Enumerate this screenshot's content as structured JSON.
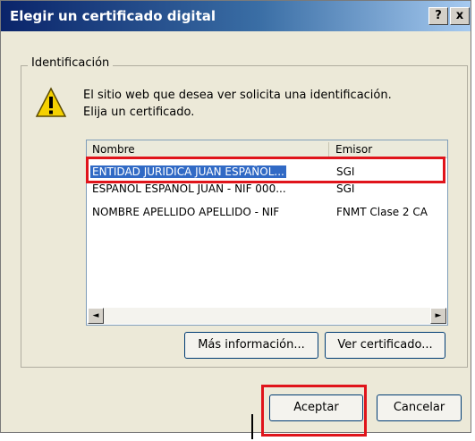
{
  "window": {
    "title": "Elegir un certificado digital",
    "help_label": "?",
    "close_label": "x"
  },
  "group": {
    "label": "Identificación"
  },
  "message": {
    "line1": "El sitio web que desea ver solicita una identificación.",
    "line2": "Elija un certificado."
  },
  "list": {
    "columns": [
      "Nombre",
      "Emisor"
    ],
    "rows": [
      {
        "name": "ENTIDAD JURIDICA JUAN ESPAÑOL...",
        "issuer": "SGI",
        "selected": true
      },
      {
        "name": "ESPAÑOL ESPAÑOL JUAN - NIF 000...",
        "issuer": "SGI",
        "selected": false
      },
      {
        "name": "NOMBRE APELLIDO APELLIDO - NIF",
        "issuer": "FNMT Clase 2 CA",
        "selected": false
      }
    ],
    "scroll_left_icon": "◄",
    "scroll_right_icon": "►"
  },
  "buttons": {
    "more_info": "Más información...",
    "view_cert": "Ver certificado...",
    "accept": "Aceptar",
    "cancel": "Cancelar"
  },
  "colors": {
    "highlight": "#e0141b",
    "selection": "#316ac5"
  }
}
